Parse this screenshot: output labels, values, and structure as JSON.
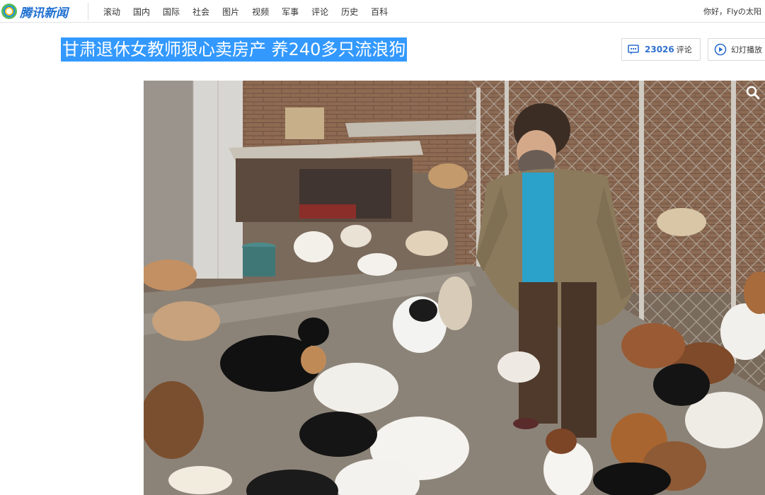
{
  "header": {
    "logo_text": "腾讯新闻",
    "nav": [
      "滚动",
      "国内",
      "国际",
      "社会",
      "图片",
      "视频",
      "军事",
      "评论",
      "历史",
      "百科"
    ],
    "greeting": "你好，Flyの太阳"
  },
  "article": {
    "title": "甘肃退休女教师狠心卖房产 养240多只流浪狗",
    "comment_count": "23026",
    "comment_label": "评论",
    "slideshow_label": "幻灯播放"
  },
  "icons": {
    "logo": "tencent-news-logo",
    "comment": "comment-icon",
    "slideshow": "play-circle-icon",
    "zoom": "magnifier-icon"
  },
  "colors": {
    "accent_blue": "#2f6fcf",
    "title_highlight": "#3399ff",
    "logo_blue": "#1e6fd1"
  }
}
